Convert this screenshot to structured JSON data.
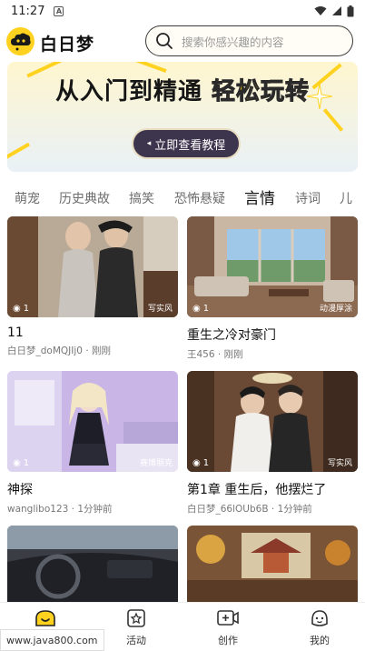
{
  "status_bar": {
    "time": "11:27",
    "notification_badge": "A"
  },
  "header": {
    "logo_text": "白日梦",
    "search_placeholder": "搜索你感兴趣的内容"
  },
  "banner": {
    "title_part1": "从入门到精通",
    "title_part2": "轻松玩转",
    "button_label": "立即查看教程",
    "accent_color": "#ffd21f"
  },
  "categories": {
    "items": [
      "萌宠",
      "历史典故",
      "搞笑",
      "恐怖悬疑",
      "言情",
      "诗词",
      "儿"
    ],
    "selected": "言情"
  },
  "cards": [
    {
      "title": "11",
      "author": "白日梦_doMQJIj0",
      "time": "刚刚",
      "views": "1",
      "style_tag": "写实风"
    },
    {
      "title": "重生之冷对豪门",
      "author": "王456",
      "time": "刚刚",
      "views": "1",
      "style_tag": "动漫厚涂"
    },
    {
      "title": "神探",
      "author": "wanglibo123",
      "time": "1分钟前",
      "views": "1",
      "style_tag": "赛博朋克"
    },
    {
      "title": "第1章 重生后，他摆烂了",
      "author": "白日梦_66lOUb6B",
      "time": "1分钟前",
      "views": "1",
      "style_tag": "写实风"
    },
    {
      "title": "",
      "author": "",
      "time": "",
      "views": "",
      "style_tag": ""
    },
    {
      "title": "",
      "author": "",
      "time": "",
      "views": "",
      "style_tag": ""
    }
  ],
  "meta_separator": "·",
  "bottom_nav": {
    "items": [
      {
        "label": "",
        "icon": "home-icon"
      },
      {
        "label": "活动",
        "icon": "activity-icon"
      },
      {
        "label": "创作",
        "icon": "create-video-icon"
      },
      {
        "label": "我的",
        "icon": "profile-icon"
      }
    ],
    "active_color": "#ffd21f"
  },
  "watermark": "www.java800.com"
}
